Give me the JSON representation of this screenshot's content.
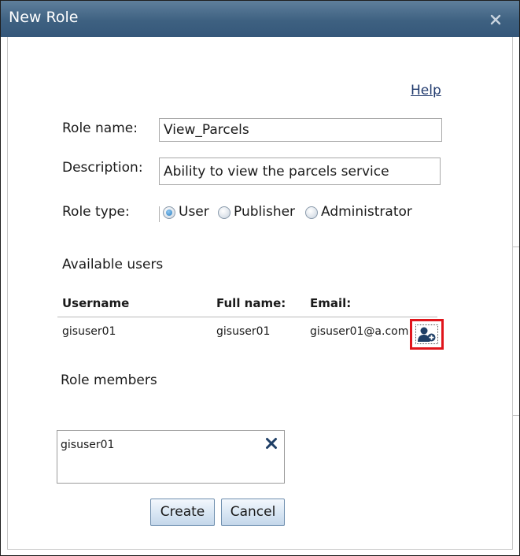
{
  "dialog": {
    "title": "New Role",
    "help_label": "Help"
  },
  "form": {
    "role_name_label": "Role name:",
    "role_name_value": "View_Parcels",
    "description_label": "Description:",
    "description_value": "Ability to view the parcels service",
    "role_type_label": "Role type:",
    "role_type_options": [
      "User",
      "Publisher",
      "Administrator"
    ],
    "role_type_selected": "User"
  },
  "available_users": {
    "heading": "Available users",
    "columns": [
      "Username",
      "Full name:",
      "Email:"
    ],
    "rows": [
      {
        "username": "gisuser01",
        "full_name": "gisuser01",
        "email": "gisuser01@a.com"
      }
    ],
    "add_icon": "add-user-icon",
    "highlight_color": "#e0151b"
  },
  "role_members": {
    "heading": "Role members",
    "items": [
      "gisuser01"
    ],
    "remove_icon": "remove-x-icon"
  },
  "actions": {
    "create_label": "Create",
    "cancel_label": "Cancel"
  },
  "colors": {
    "titlebar": "#3e6181",
    "link": "#223b6e",
    "accent_icon": "#1f3f66"
  }
}
